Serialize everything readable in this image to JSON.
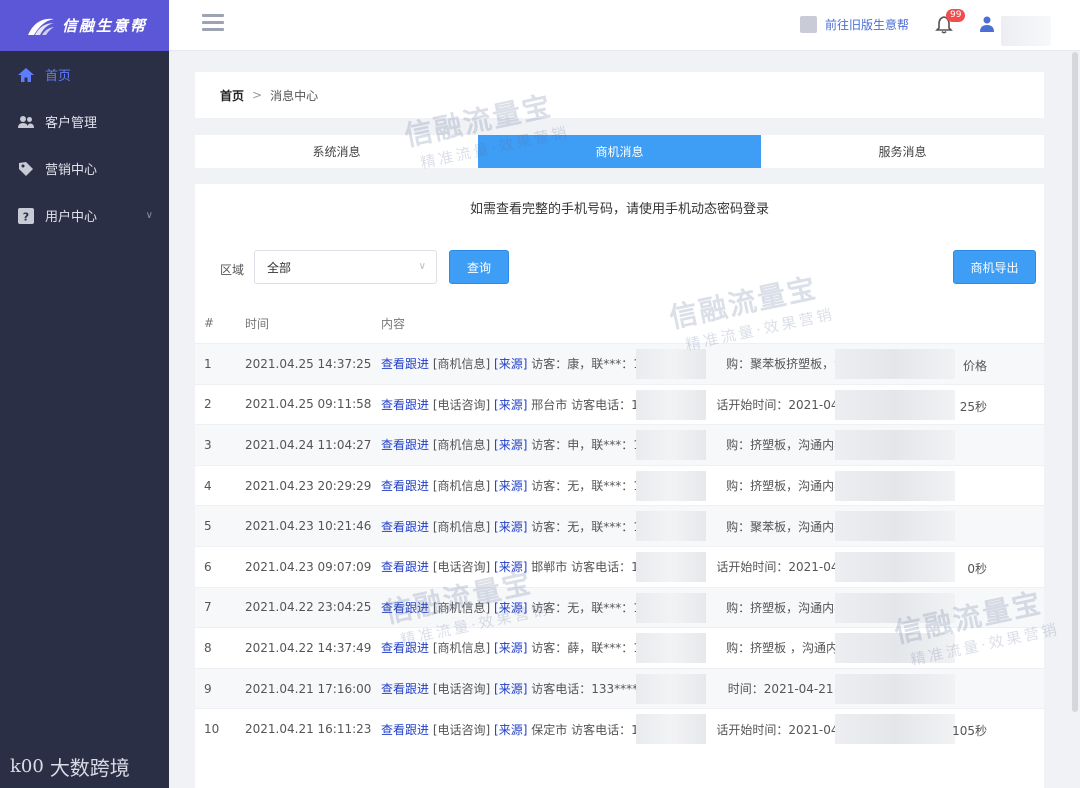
{
  "app": {
    "logo_text": "信融生意帮"
  },
  "sidebar": {
    "items": [
      {
        "label": "首页",
        "icon": "home-icon",
        "active": true
      },
      {
        "label": "客户管理",
        "icon": "users-icon"
      },
      {
        "label": "营销中心",
        "icon": "tag-icon"
      },
      {
        "label": "用户中心",
        "icon": "help-icon",
        "has_submenu": true
      }
    ],
    "bottom_brand": "大数跨境",
    "bottom_mark": "k00"
  },
  "header": {
    "old_version_link": "前往旧版生意帮",
    "notification_count": "99"
  },
  "breadcrumb": {
    "home": "首页",
    "separator": ">",
    "current": "消息中心"
  },
  "tabs": [
    {
      "label": "系统消息",
      "active": false
    },
    {
      "label": "商机消息",
      "active": true
    },
    {
      "label": "服务消息",
      "active": false
    }
  ],
  "notice": "如需查看完整的手机号码，请使用手机动态密码登录",
  "filter": {
    "region_label": "区域",
    "region_value": "全部",
    "query_button": "查询",
    "export_button": "商机导出"
  },
  "table": {
    "columns": [
      "#",
      "时间",
      "内容"
    ],
    "rows": [
      {
        "num": "1",
        "time": "2021.04.25 14:37:25",
        "link": "查看跟进",
        "type": "[商机信息]",
        "src": "[来源]",
        "text": "访客：康，联***：156",
        "mid": "购：聚苯板挤塑板，沟通内",
        "tail": "价格"
      },
      {
        "num": "2",
        "time": "2021.04.25 09:11:58",
        "link": "查看跟进",
        "type": "[电话咨询]",
        "src": "[来源]",
        "text": "邢台市 访客电话：18",
        "mid": "话开始时间：2021-04-25",
        "tail": "25秒"
      },
      {
        "num": "3",
        "time": "2021.04.24 11:04:27",
        "link": "查看跟进",
        "type": "[商机信息]",
        "src": "[来源]",
        "text": "访客：申，联***：134",
        "mid": "购：挤塑板，沟通内容：",
        "tail": ""
      },
      {
        "num": "4",
        "time": "2021.04.23 20:29:29",
        "link": "查看跟进",
        "type": "[商机信息]",
        "src": "[来源]",
        "text": "访客：无，联***：136",
        "mid": "购：挤塑板，沟通内容：",
        "tail": ""
      },
      {
        "num": "5",
        "time": "2021.04.23 10:21:46",
        "link": "查看跟进",
        "type": "[商机信息]",
        "src": "[来源]",
        "text": "访客：无，联***：135",
        "mid": "购：聚苯板，沟通内容：",
        "tail": ""
      },
      {
        "num": "6",
        "time": "2021.04.23 09:07:09",
        "link": "查看跟进",
        "type": "[电话咨询]",
        "src": "[来源]",
        "text": "邯郸市 访客电话：15",
        "mid": "话开始时间：2021-04-23",
        "tail": "0秒"
      },
      {
        "num": "7",
        "time": "2021.04.22 23:04:25",
        "link": "查看跟进",
        "type": "[商机信息]",
        "src": "[来源]",
        "text": "访客：无，联***：139",
        "mid": "购：挤塑板，沟通内容：",
        "tail": ""
      },
      {
        "num": "8",
        "time": "2021.04.22 14:37:49",
        "link": "查看跟进",
        "type": "[商机信息]",
        "src": "[来源]",
        "text": "访客：薛，联***：188",
        "mid": "购：挤塑板 ，沟通内容：",
        "tail": ""
      },
      {
        "num": "9",
        "time": "2021.04.21 17:16:00",
        "link": "查看跟进",
        "type": "[电话咨询]",
        "src": "[来源]",
        "text": "访客电话：133******3",
        "mid": "时间：2021-04-21 17:00",
        "tail": ""
      },
      {
        "num": "10",
        "time": "2021.04.21 16:11:23",
        "link": "查看跟进",
        "type": "[电话咨询]",
        "src": "[来源]",
        "text": "保定市 访客电话：17",
        "mid": "话开始时间：2021-04-21",
        "tail": "105秒"
      }
    ]
  },
  "watermark": {
    "title": "信融流量宝",
    "subtitle": "精准流量·效果营销"
  },
  "colors": {
    "sidebar_bg": "#2b2f45",
    "logo_bg": "#5b57d6",
    "accent": "#3e9df5",
    "link": "#2340c8",
    "badge": "#f14d4d"
  }
}
